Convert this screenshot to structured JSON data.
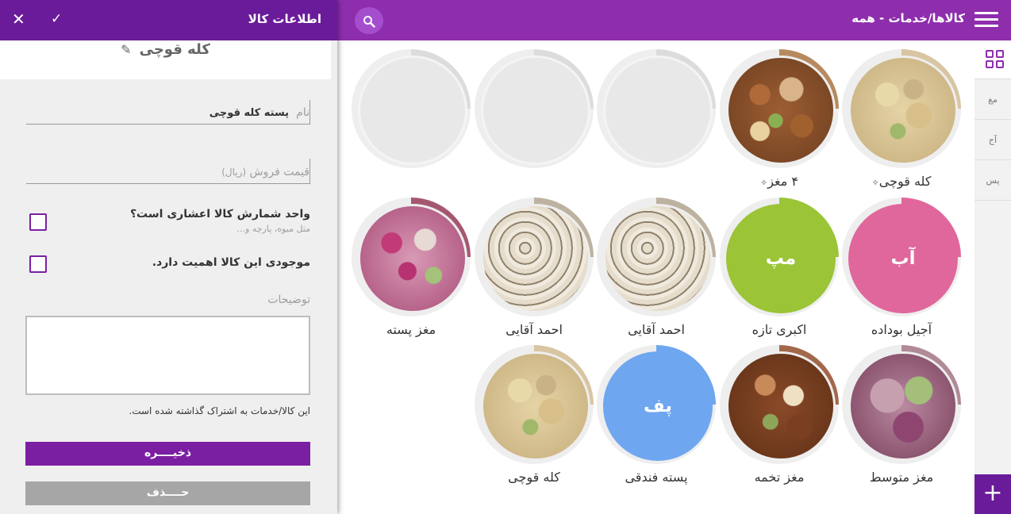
{
  "form_panel": {
    "title": "اطلاعات کالا",
    "confirm_icon": "check-icon",
    "close_icon": "close-icon",
    "product_name": "کله قوچی",
    "name_field": {
      "label": "نام",
      "value": "پسته کله قوچی"
    },
    "price_field": {
      "label": "قیمت فروش",
      "unit": "(ریال)"
    },
    "decimal_unit": {
      "question": "واحد شمارش کالا اعشاری است؟",
      "hint": "مثل میوه، پارچه و..."
    },
    "stock_matters": {
      "question": "موجودی این کالا اهمیت دارد."
    },
    "notes_label": "توضیحات",
    "shared_note": "این کالا/خدمات به اشتراک گذاشته شده است.",
    "save_label": "ذخیــــره",
    "delete_label": "حــــذف"
  },
  "main": {
    "title": "کالاها/خدمات - همه",
    "search_icon": "search-icon",
    "menu_icon": "menu-icon"
  },
  "side_tabs": [
    "مغ",
    "آج",
    "پس"
  ],
  "add_label": "+",
  "colors": {
    "primary_dark": "#6a1b9a",
    "primary": "#8e2ead",
    "accent_pink": "#e0679c",
    "accent_green": "#9bc437",
    "accent_blue": "#6ea6f0"
  },
  "items": [
    {
      "label": "کله قوچی",
      "pinned": true,
      "kind": "photo",
      "photo": "pistachio-shell"
    },
    {
      "label": "۴ مغز",
      "pinned": true,
      "kind": "photo",
      "photo": "mixed-nuts"
    },
    {
      "label": "",
      "kind": "empty"
    },
    {
      "label": "",
      "kind": "empty"
    },
    {
      "label": "",
      "kind": "empty"
    },
    {
      "label": "آجیل بوداده",
      "kind": "initial",
      "initial": "آب",
      "color": "#e0679c"
    },
    {
      "label": "اکبری تازه",
      "kind": "initial",
      "initial": "مپ",
      "color": "#9bc437"
    },
    {
      "label": "احمد آقایی",
      "kind": "photo",
      "photo": "pistachio-beige"
    },
    {
      "label": "احمد آقایی",
      "kind": "photo",
      "photo": "pistachio-beige"
    },
    {
      "label": "مغز پسته",
      "kind": "photo",
      "photo": "pistachio-kernel"
    },
    {
      "label": "مغز متوسط",
      "kind": "photo",
      "photo": "pistachio-kernel-large"
    },
    {
      "label": "مغز تخمه",
      "kind": "photo",
      "photo": "mixed-nuts-dark"
    },
    {
      "label": "پسته فندقی",
      "kind": "initial",
      "initial": "پف",
      "color": "#6ea6f0"
    },
    {
      "label": "کله قوچی",
      "kind": "photo",
      "photo": "pistachio-shell"
    }
  ]
}
